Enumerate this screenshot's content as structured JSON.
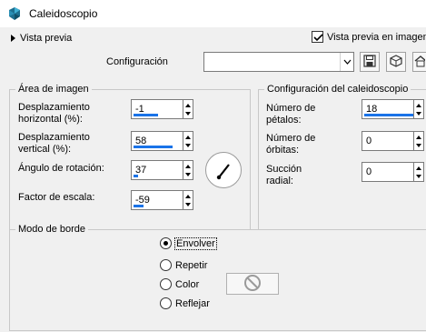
{
  "window": {
    "title": "Caleidoscopio",
    "icon": "kaleidoscope-app-icon"
  },
  "top": {
    "preview_toggle_label": "Vista previa",
    "preview_in_image_label": "Vista previa en imagen",
    "preview_in_image_checked": true,
    "config_label": "Configuración",
    "config_value": "",
    "toolbar_icons": [
      "save-icon",
      "cube-icon",
      "home-icon"
    ]
  },
  "image_area": {
    "title": "Área de imagen",
    "fields": [
      {
        "label_line1": "Desplazamiento",
        "label_line2": "horizontal (%):",
        "value": "-1",
        "fill": 0.5
      },
      {
        "label_line1": "Desplazamiento",
        "label_line2": "vertical (%):",
        "value": "58",
        "fill": 0.79
      },
      {
        "label_line1": "Ángulo de rotación:",
        "label_line2": "",
        "value": "37",
        "fill": 0.1
      },
      {
        "label_line1": "Factor de escala:",
        "label_line2": "",
        "value": "-59",
        "fill": 0.2
      }
    ]
  },
  "kaleido_config": {
    "title": "Configuración del caleidoscopio",
    "fields": [
      {
        "label_line1": "Número de",
        "label_line2": "pétalos:",
        "value": "18",
        "fill": 1.0
      },
      {
        "label_line1": "Número de",
        "label_line2": "órbitas:",
        "value": "0",
        "fill": 0
      },
      {
        "label_line1": "Succión",
        "label_line2": "radial:",
        "value": "0",
        "fill": 0
      }
    ]
  },
  "border_mode": {
    "title": "Modo de borde",
    "options": [
      "Envolver",
      "Repetir",
      "Color",
      "Reflejar"
    ],
    "selected": "Envolver"
  },
  "colors": {
    "accent": "#1a73e8",
    "panel_bg": "#f0f0f0"
  }
}
